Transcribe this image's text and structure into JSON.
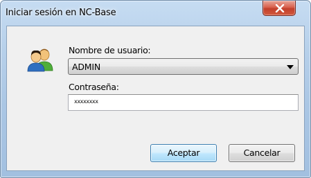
{
  "window": {
    "title": "Iniciar sesión en NC-Base"
  },
  "form": {
    "username_label": "Nombre de usuario:",
    "username_value": "ADMIN",
    "password_label": "Contraseña:",
    "password_value": "xxxxxxxx"
  },
  "buttons": {
    "accept_label": "Aceptar",
    "cancel_label": "Cancelar"
  },
  "icons": {
    "close": "close-icon",
    "users": "users-icon",
    "dropdown": "chevron-down-icon"
  },
  "colors": {
    "title_bar": "#b7d0ea",
    "close_button": "#c2402b",
    "default_button": "#bee6fd",
    "client_area": "#f0f0f0"
  }
}
